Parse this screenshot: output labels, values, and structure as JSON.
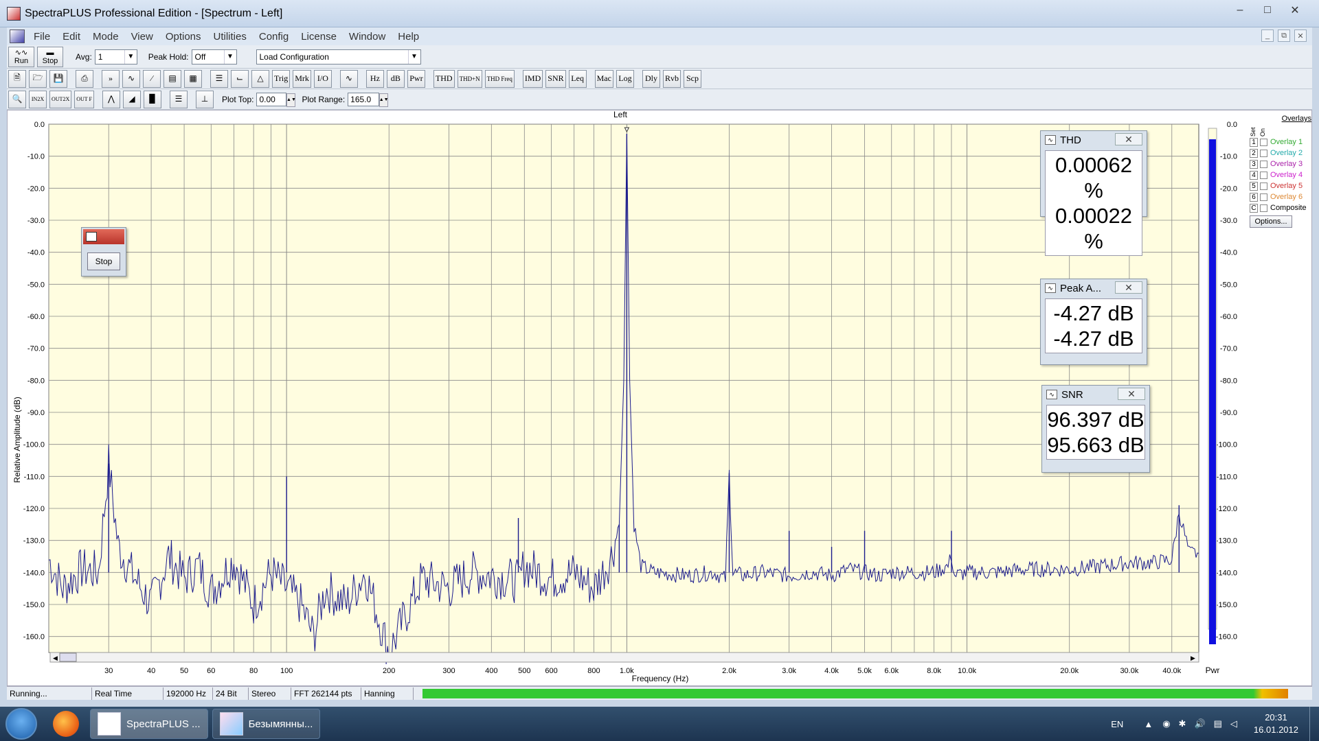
{
  "window": {
    "title": "SpectraPLUS Professional Edition - [Spectrum - Left]"
  },
  "menu": [
    "File",
    "Edit",
    "Mode",
    "View",
    "Options",
    "Utilities",
    "Config",
    "License",
    "Window",
    "Help"
  ],
  "toolbar1": {
    "run": "Run",
    "stop": "Stop",
    "avg_label": "Avg:",
    "avg_value": "1",
    "peakhold_label": "Peak Hold:",
    "peakhold_value": "Off",
    "config_value": "Load Configuration"
  },
  "toolbar2": [
    "Hz",
    "dB",
    "Pwr",
    "THD",
    "THD+N",
    "THD Freq",
    "IMD",
    "SNR",
    "Leq",
    "Mac",
    "Log",
    "Dly",
    "Rvb",
    "Scp"
  ],
  "toolbar3": {
    "plot_top_label": "Plot Top:",
    "plot_top_value": "0.00",
    "plot_range_label": "Plot Range:",
    "plot_range_value": "165.0"
  },
  "plot": {
    "title": "Left",
    "ylabel": "Relative Amplitude (dB)",
    "xlabel": "Frequency (Hz)",
    "yticks": [
      "0.0",
      "-10.0",
      "-20.0",
      "-30.0",
      "-40.0",
      "-50.0",
      "-60.0",
      "-70.0",
      "-80.0",
      "-90.0",
      "-100.0",
      "-110.0",
      "-120.0",
      "-130.0",
      "-140.0",
      "-150.0",
      "-160.0"
    ],
    "xticks": [
      "30",
      "40",
      "50",
      "60",
      "80",
      "100",
      "200",
      "300",
      "400",
      "500",
      "600",
      "800",
      "1.0k",
      "2.0k",
      "3.0k",
      "4.0k",
      "5.0k",
      "6.0k",
      "8.0k",
      "10.0k",
      "20.0k",
      "30.0k",
      "40.0k"
    ],
    "pwr_label": "Pwr",
    "plot_bg": "#fffde0",
    "trace_color": "#1a1a8c",
    "meter_color": "#1010e0"
  },
  "chart_data": {
    "type": "line",
    "title": "Left",
    "xlabel": "Frequency (Hz)",
    "ylabel": "Relative Amplitude (dB)",
    "xscale": "log",
    "xlim": [
      20,
      48000
    ],
    "ylim": [
      -165,
      0
    ],
    "series": [
      {
        "name": "Left",
        "x": [
          20,
          22,
          25,
          28,
          30,
          32,
          35,
          40,
          45,
          50,
          55,
          60,
          70,
          80,
          90,
          100,
          110,
          120,
          130,
          150,
          170,
          200,
          250,
          300,
          350,
          400,
          450,
          480,
          500,
          600,
          700,
          800,
          850,
          900,
          950,
          980,
          1000,
          1020,
          1050,
          1100,
          1200,
          1500,
          1800,
          1950,
          2000,
          2050,
          2200,
          2500,
          3000,
          3500,
          4000,
          4500,
          5000,
          5500,
          6000,
          7000,
          8000,
          8800,
          9000,
          9200,
          10000,
          12000,
          15000,
          20000,
          25000,
          30000,
          35000,
          40000,
          42000,
          45000,
          48000
        ],
        "y": [
          -136,
          -145,
          -139,
          -140,
          -106,
          -132,
          -140,
          -150,
          -135,
          -142,
          -138,
          -146,
          -136,
          -150,
          -140,
          -145,
          -150,
          -160,
          -145,
          -150,
          -140,
          -165,
          -142,
          -145,
          -140,
          -141,
          -142,
          -143,
          -138,
          -142,
          -140,
          -145,
          -140,
          -135,
          -125,
          -80,
          -3,
          -80,
          -125,
          -138,
          -140,
          -141,
          -140,
          -142,
          -109,
          -140,
          -141,
          -140,
          -141,
          -140,
          -141,
          -139,
          -140,
          -141,
          -140,
          -140,
          -140,
          -138,
          -135,
          -141,
          -140,
          -140,
          -139,
          -139,
          -138,
          -137,
          -137,
          -136,
          -121,
          -134,
          -134
        ]
      }
    ],
    "peaks": [
      {
        "x": 30,
        "y": -106
      },
      {
        "x": 100,
        "y": -110
      },
      {
        "x": 480,
        "y": -123
      },
      {
        "x": 950,
        "y": -125
      },
      {
        "x": 1000,
        "y": -3
      },
      {
        "x": 2000,
        "y": -109
      },
      {
        "x": 3000,
        "y": -127
      },
      {
        "x": 4000,
        "y": -132
      },
      {
        "x": 5000,
        "y": -127
      },
      {
        "x": 9000,
        "y": -127
      },
      {
        "x": 42000,
        "y": -119
      }
    ],
    "grid": true
  },
  "readouts": [
    {
      "title": "THD",
      "line1": "0.00062 %",
      "line2": "0.00022 %"
    },
    {
      "title": "Peak A...",
      "line1": "-4.27 dB",
      "line2": "-4.27 dB"
    },
    {
      "title": "SNR",
      "line1": "96.397 dB",
      "line2": "95.663 dB"
    }
  ],
  "overlays": {
    "header": "Overlays",
    "set": "Set",
    "on": "On",
    "items": [
      {
        "num": "1",
        "label": "Overlay 1",
        "color": "#33aa33"
      },
      {
        "num": "2",
        "label": "Overlay 2",
        "color": "#22aaaa"
      },
      {
        "num": "3",
        "label": "Overlay 3",
        "color": "#aa22aa"
      },
      {
        "num": "4",
        "label": "Overlay 4",
        "color": "#cc22cc"
      },
      {
        "num": "5",
        "label": "Overlay 5",
        "color": "#cc3333"
      },
      {
        "num": "6",
        "label": "Overlay 6",
        "color": "#dd8833"
      },
      {
        "num": "C",
        "label": "Composite",
        "color": "#000000"
      }
    ],
    "options": "Options..."
  },
  "stop_dialog": {
    "button": "Stop"
  },
  "status": [
    "Running...",
    "Real Time",
    "192000 Hz",
    "24 Bit",
    "Stereo",
    "FFT 262144 pts",
    "Hanning"
  ],
  "taskbar": {
    "tasks": [
      "SpectraPLUS ...",
      "Безымянны..."
    ],
    "lang": "EN",
    "time": "20:31",
    "date": "16.01.2012"
  }
}
